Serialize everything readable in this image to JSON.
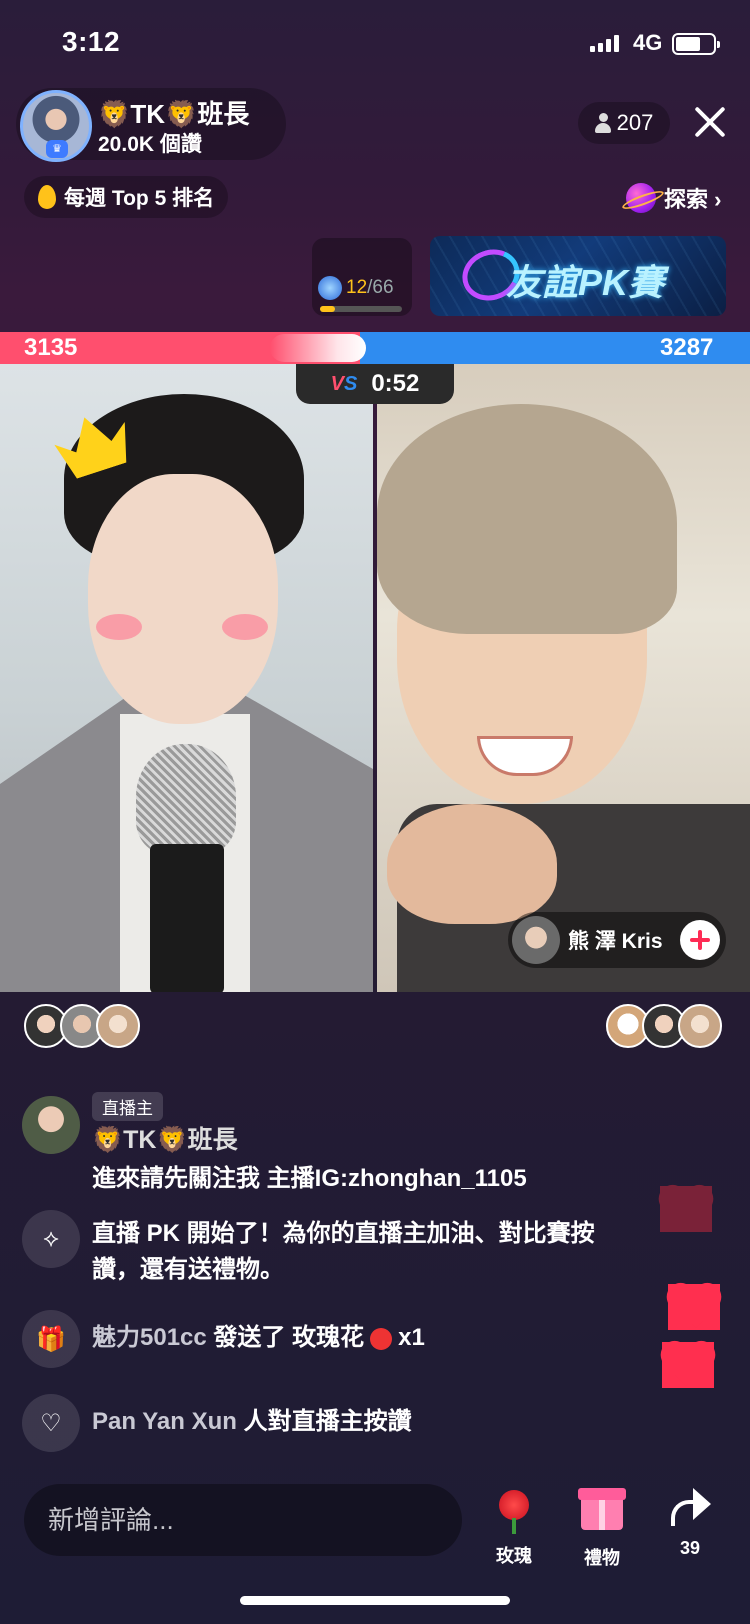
{
  "status_bar": {
    "time": "3:12",
    "network": "4G"
  },
  "host": {
    "name": "🦁TK🦁班長",
    "likes": "20.0K 個讚"
  },
  "viewers": {
    "count": "207"
  },
  "weekly_rank": {
    "label": "每週 Top 5 排名"
  },
  "explore": {
    "label": "探索 ›"
  },
  "level": {
    "current": "12",
    "total": "/66",
    "progress": 0.18
  },
  "pk_banner": {
    "title": "友誼PK賽"
  },
  "pk": {
    "left_score": "3135",
    "right_score": "3287",
    "timer": "0:52",
    "vs_v": "V",
    "vs_s": "S"
  },
  "guest": {
    "name": "熊 澤 Kris"
  },
  "chat": {
    "host_chip": "直播主",
    "host_name": "🦁TK🦁班長",
    "host_msg": "進來請先關注我 主播IG:zhonghan_1105",
    "pk_line1": "直播 PK 開始了！為你的直播主加油、對比賽按",
    "pk_line2": "讚，還有送禮物。",
    "gift_user": "魅力501cc",
    "gift_text": "發送了 玫瑰花",
    "gift_count": "x1",
    "like_user": "Pan Yan Xun",
    "like_text": "人對直播主按讚"
  },
  "bottom": {
    "comment_placeholder": "新增評論...",
    "rose_label": "玫瑰",
    "gift_label": "禮物",
    "share_count": "39"
  },
  "colors": {
    "red_team": "#ff4f6e",
    "blue_team": "#2f8cf0",
    "heart": "#ff2f4f"
  }
}
